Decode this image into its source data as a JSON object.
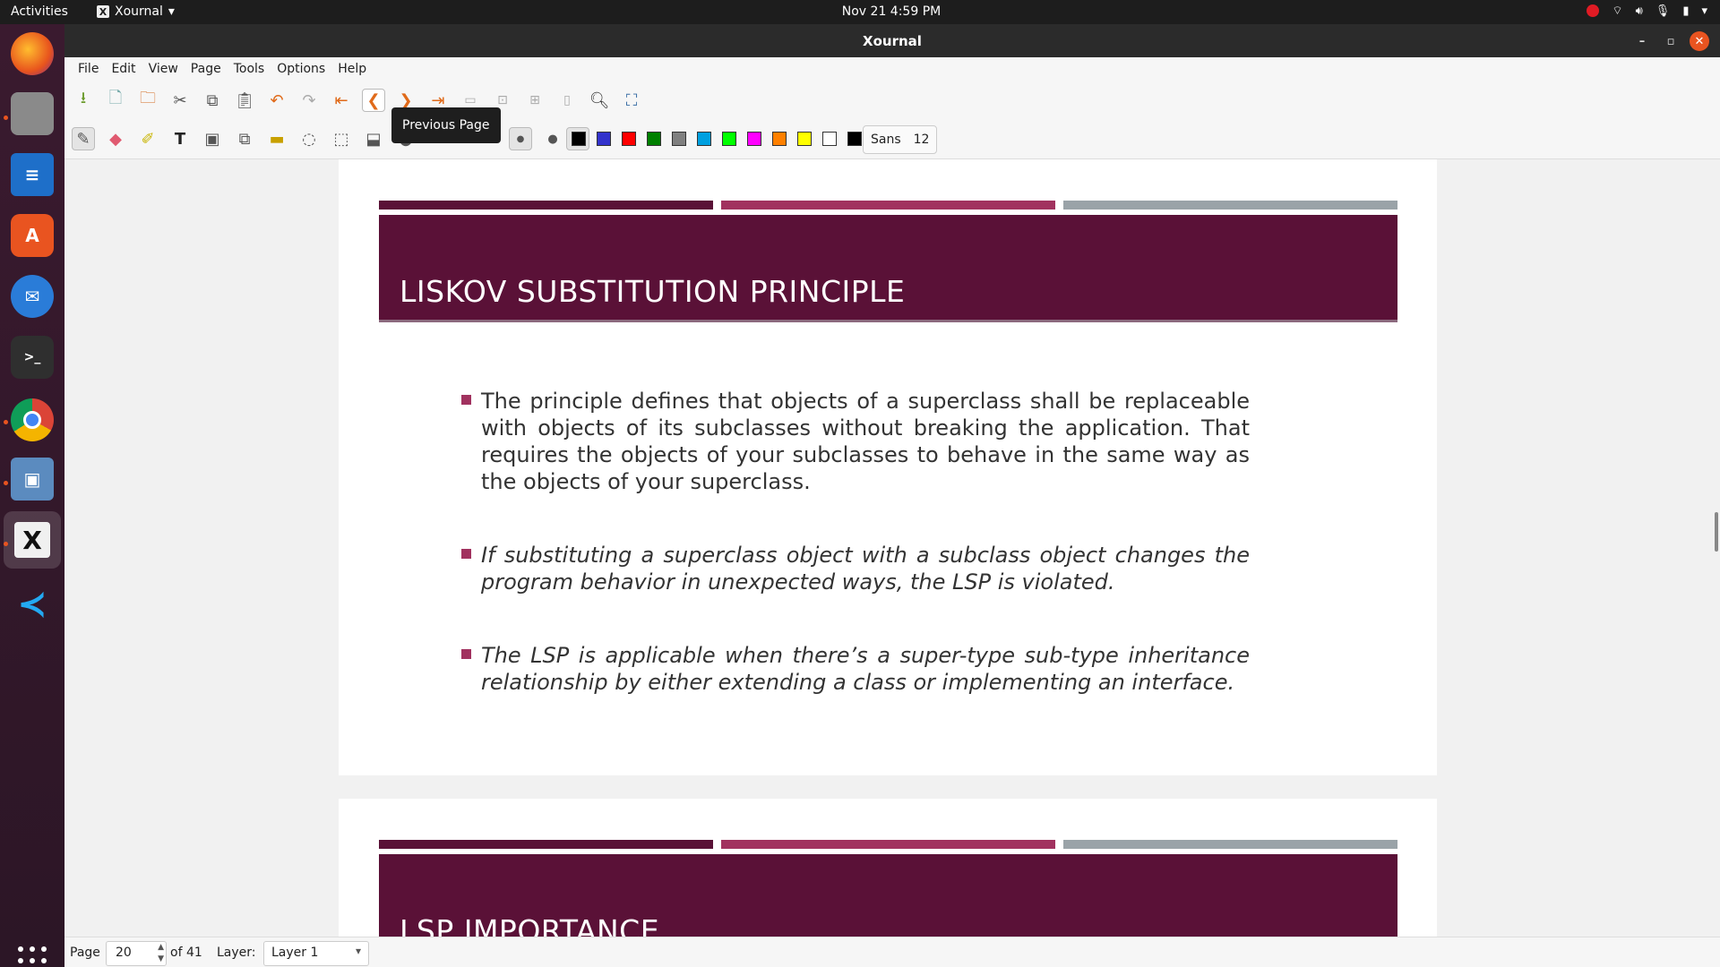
{
  "topbar": {
    "activities": "Activities",
    "app_name": "Xournal",
    "clock": "Nov 21  4:59 PM"
  },
  "window": {
    "title": "Xournal"
  },
  "menu": [
    "File",
    "Edit",
    "View",
    "Page",
    "Tools",
    "Options",
    "Help"
  ],
  "tooltip": "Previous Page",
  "toolbar": {
    "font_name": "Sans",
    "font_size": "12"
  },
  "colors": {
    "accent_banner": "#5a1137",
    "stripe1": "#5a1137",
    "stripe2": "#a1325f",
    "stripe3": "#9aa3a8",
    "bullet": "#a1325f"
  },
  "palette": [
    "#000000",
    "#3333cc",
    "#ff0000",
    "#008000",
    "#808080",
    "#00a0e0",
    "#00ff00",
    "#ff00ff",
    "#ff8000",
    "#ffff00",
    "#ffffff",
    "#000000"
  ],
  "slide1": {
    "heading": "LISKOV SUBSTITUTION PRINCIPLE",
    "bullets": [
      "The principle defines that objects of a superclass shall be replaceable with objects of its subclasses without breaking the application. That requires the objects of your subclasses to behave in the same way as the objects of your superclass.",
      "If substituting a superclass object with a subclass object changes the program behavior in unexpected ways, the LSP is violated.",
      "The LSP is applicable when there’s a super-type sub-type inheritance relationship by either extending a class or implementing an interface."
    ]
  },
  "slide2": {
    "heading": "LSP IMPORTANCE"
  },
  "status": {
    "page_label": "Page",
    "page_value": "20",
    "of_total": "of 41",
    "layer_label": "Layer:",
    "layer_value": "Layer 1"
  }
}
